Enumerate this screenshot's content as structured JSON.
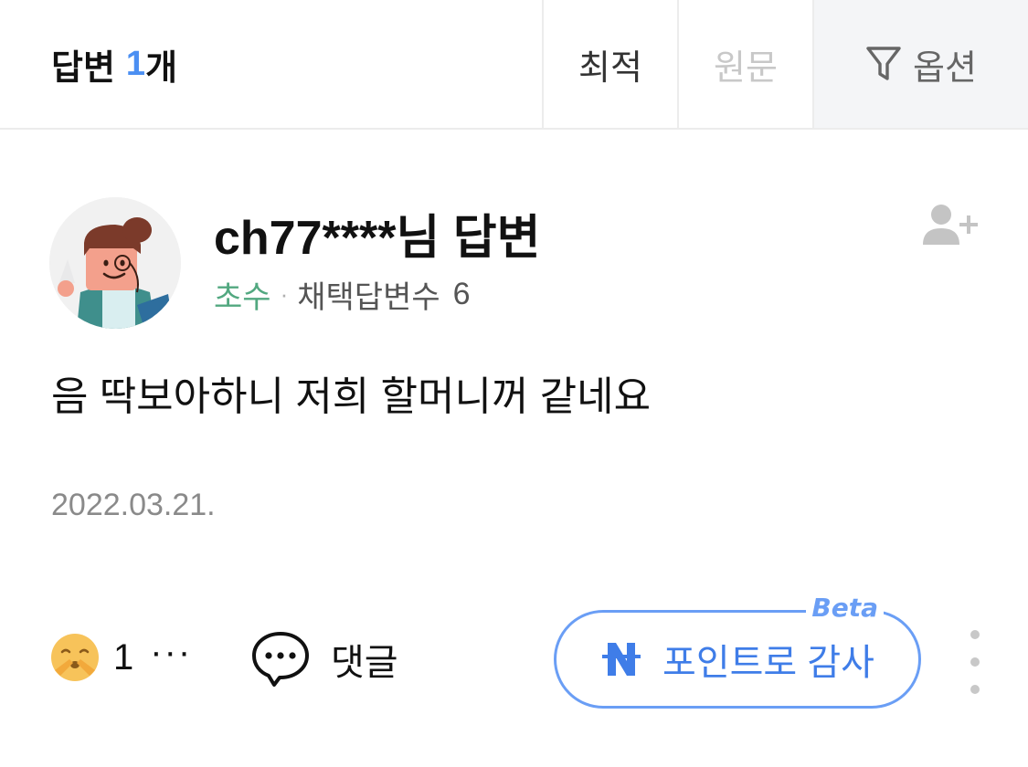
{
  "header": {
    "title_prefix": "답변",
    "answer_count": "1",
    "title_unit": "개",
    "tabs": [
      {
        "label": "최적",
        "active": true
      },
      {
        "label": "원문",
        "active": false
      }
    ],
    "option_label": "옵션",
    "option_icon": "filter-icon"
  },
  "answer": {
    "author_name": "ch77****님 답변",
    "author_level": "초수",
    "meta_separator": "·",
    "adopted_label": "채택답변수",
    "adopted_count": "6",
    "body": "음 딱보아하니 저희 할머니꺼 같네요",
    "date": "2022.03.21.",
    "follow_icon": "add-user-icon"
  },
  "actions": {
    "reaction_icon": "shushing-face-emoji",
    "reaction_count": "1",
    "reaction_more": "···",
    "comment_icon": "speech-bubble-icon",
    "comment_label": "댓글",
    "thanks_icon": "naver-pay-n-icon",
    "thanks_label": "포인트로 감사",
    "beta_label": "Beta",
    "more_icon": "vertical-ellipsis-icon"
  },
  "colors": {
    "accent_blue": "#4b8ff2",
    "level_green": "#52a880",
    "muted_gray": "#8a8a8a",
    "border": "#ececec"
  }
}
